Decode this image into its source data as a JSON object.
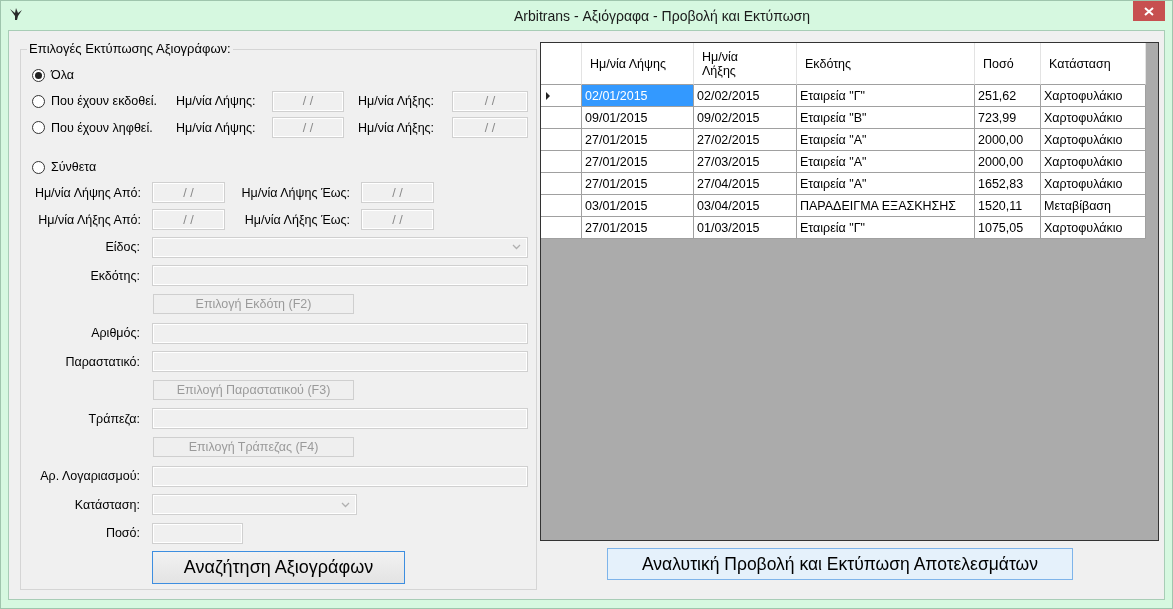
{
  "window": {
    "title": "Arbitrans - Αξιόγραφα - Προβολή και Εκτύπωση"
  },
  "filters": {
    "title": "Επιλογές Εκτύπωσης Αξιογράφων:",
    "options": [
      {
        "kind": "plain",
        "label": "Όλα",
        "selected": true
      },
      {
        "kind": "dates",
        "label": "Που έχουν εκδοθεί.",
        "selected": false,
        "dates": [
          {
            "label": "Ημ/νία Λήψης:",
            "value": "/ /",
            "disabled": true
          },
          {
            "label": "Ημ/νία Λήξης:",
            "value": "/ /",
            "disabled": true
          }
        ]
      },
      {
        "kind": "dates",
        "label": "Που έχουν ληφθεί.",
        "selected": false,
        "dates": [
          {
            "label": "Ημ/νία Λήψης:",
            "value": "/ /",
            "disabled": true
          },
          {
            "label": "Ημ/νία Λήξης:",
            "value": "/ /",
            "disabled": true
          }
        ]
      },
      {
        "kind": "ranges",
        "label": "Σύνθετα",
        "selected": false,
        "ranges": [
          {
            "label": "Ημ/νία Λήψης Από:",
            "value": "/ /",
            "disabled": true
          },
          {
            "label": "Ημ/νία Λήψης Έως:",
            "value": "/ /",
            "disabled": true
          },
          {
            "label": "Ημ/νία Λήξης Από:",
            "value": "/ /",
            "disabled": true
          },
          {
            "label": "Ημ/νία Λήξης Έως:",
            "value": "/ /",
            "disabled": true
          }
        ]
      }
    ],
    "fields": [
      {
        "kind": "combo",
        "label": "Είδος:",
        "disabled": true
      },
      {
        "kind": "text",
        "label": "Εκδότης:",
        "disabled": true
      },
      {
        "kind": "button",
        "label": "Επιλογή Εκδότη (F2)",
        "disabled": true
      },
      {
        "kind": "text",
        "label": "Αριθμός:",
        "disabled": true
      },
      {
        "kind": "text",
        "label": "Παραστατικό:",
        "disabled": true
      },
      {
        "kind": "button",
        "label": "Επιλογή Παραστατικού (F3)",
        "disabled": true
      },
      {
        "kind": "text",
        "label": "Τράπεζα:",
        "disabled": true
      },
      {
        "kind": "button",
        "label": "Επιλογή Τράπεζας (F4)",
        "disabled": true
      },
      {
        "kind": "text",
        "label": "Αρ. Λογαριασμού:",
        "disabled": true
      },
      {
        "kind": "combo",
        "label": "Κατάσταση:",
        "disabled": true
      },
      {
        "kind": "text",
        "label": "Ποσό:",
        "disabled": true
      }
    ],
    "search_button": "Αναζήτηση Αξιογράφων"
  },
  "table": {
    "columns": [
      "Ημ/νία Λήψης",
      "Ημ/νία\nΛήξης",
      "Εκδότης",
      "Ποσό",
      "Κατάσταση"
    ],
    "rows": [
      {
        "current": true,
        "cells": [
          {
            "text": "02/01/2015",
            "selected": true
          },
          {
            "text": "02/02/2015",
            "selected": false
          },
          {
            "text": "Εταιρεία \"Γ\"",
            "selected": false
          },
          {
            "text": "251,62",
            "selected": false
          },
          {
            "text": "Χαρτοφυλάκιο",
            "selected": false
          }
        ]
      },
      {
        "current": false,
        "cells": [
          {
            "text": "09/01/2015",
            "selected": false
          },
          {
            "text": "09/02/2015",
            "selected": false
          },
          {
            "text": "Εταιρεία \"Β\"",
            "selected": false
          },
          {
            "text": "723,99",
            "selected": false
          },
          {
            "text": "Χαρτοφυλάκιο",
            "selected": false
          }
        ]
      },
      {
        "current": false,
        "cells": [
          {
            "text": "27/01/2015",
            "selected": false
          },
          {
            "text": "27/02/2015",
            "selected": false
          },
          {
            "text": "Εταιρεία \"Α\"",
            "selected": false
          },
          {
            "text": "2000,00",
            "selected": false
          },
          {
            "text": "Χαρτοφυλάκιο",
            "selected": false
          }
        ]
      },
      {
        "current": false,
        "cells": [
          {
            "text": "27/01/2015",
            "selected": false
          },
          {
            "text": "27/03/2015",
            "selected": false
          },
          {
            "text": "Εταιρεία \"Α\"",
            "selected": false
          },
          {
            "text": "2000,00",
            "selected": false
          },
          {
            "text": "Χαρτοφυλάκιο",
            "selected": false
          }
        ]
      },
      {
        "current": false,
        "cells": [
          {
            "text": "27/01/2015",
            "selected": false
          },
          {
            "text": "27/04/2015",
            "selected": false
          },
          {
            "text": "Εταιρεία \"Α\"",
            "selected": false
          },
          {
            "text": "1652,83",
            "selected": false
          },
          {
            "text": "Χαρτοφυλάκιο",
            "selected": false
          }
        ]
      },
      {
        "current": false,
        "cells": [
          {
            "text": "03/01/2015",
            "selected": false
          },
          {
            "text": "03/04/2015",
            "selected": false
          },
          {
            "text": "ΠΑΡΑΔΕΙΓΜΑ ΕΞΑΣΚΗΣΗΣ",
            "selected": false
          },
          {
            "text": "1520,11",
            "selected": false
          },
          {
            "text": "Μεταβίβαση",
            "selected": false
          }
        ]
      },
      {
        "current": false,
        "cells": [
          {
            "text": "27/01/2015",
            "selected": false
          },
          {
            "text": "01/03/2015",
            "selected": false
          },
          {
            "text": "Εταιρεία \"Γ\"",
            "selected": false
          },
          {
            "text": "1075,05",
            "selected": false
          },
          {
            "text": "Χαρτοφυλάκιο",
            "selected": false
          }
        ]
      }
    ]
  },
  "details_button": "Αναλυτική Προβολή και Εκτύπωση Αποτελεσμάτων"
}
